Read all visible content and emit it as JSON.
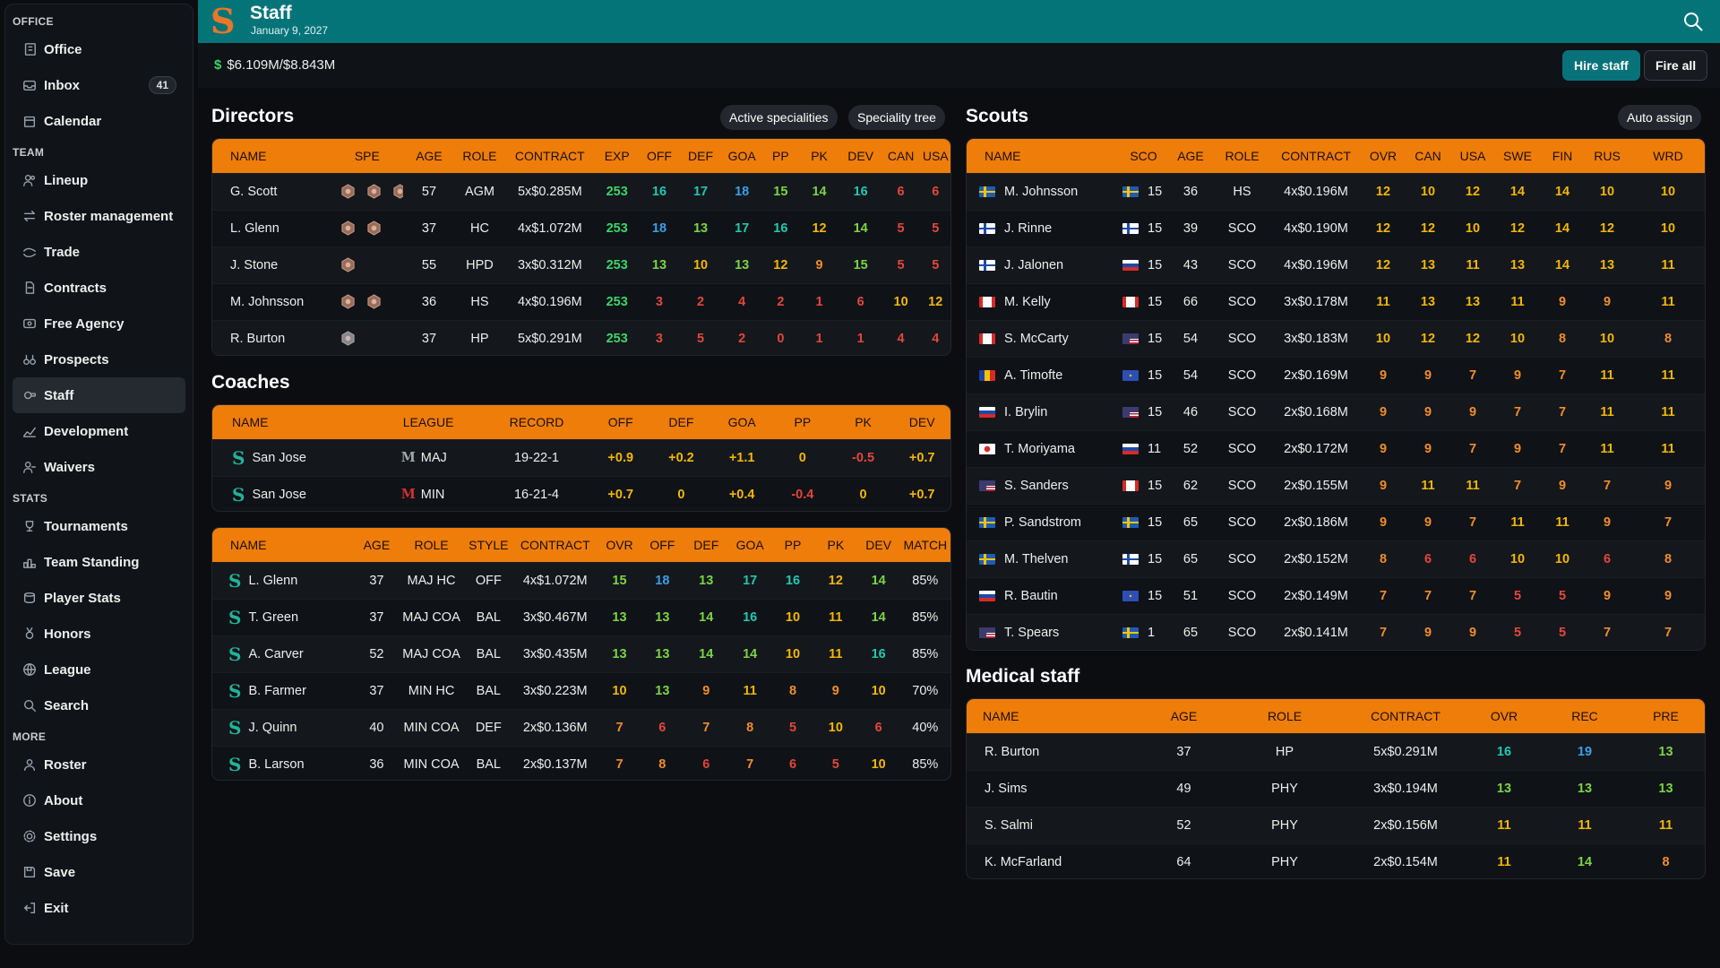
{
  "sidebar": {
    "office_title": "OFFICE",
    "team_title": "TEAM",
    "stats_title": "STATS",
    "more_title": "MORE",
    "office": [
      {
        "label": "Office",
        "icon": "building-icon"
      },
      {
        "label": "Inbox",
        "icon": "inbox-icon",
        "badge": "41"
      },
      {
        "label": "Calendar",
        "icon": "calendar-icon"
      }
    ],
    "team": [
      {
        "label": "Lineup",
        "icon": "users-icon"
      },
      {
        "label": "Roster management",
        "icon": "swap-icon"
      },
      {
        "label": "Trade",
        "icon": "trade-icon"
      },
      {
        "label": "Contracts",
        "icon": "document-icon"
      },
      {
        "label": "Free Agency",
        "icon": "id-card-icon"
      },
      {
        "label": "Prospects",
        "icon": "binoculars-icon"
      },
      {
        "label": "Staff",
        "icon": "whistle-icon",
        "active": true
      },
      {
        "label": "Development",
        "icon": "chart-icon"
      },
      {
        "label": "Waivers",
        "icon": "user-remove-icon"
      }
    ],
    "stats": [
      {
        "label": "Tournaments",
        "icon": "trophy-icon"
      },
      {
        "label": "Team Standing",
        "icon": "podium-icon"
      },
      {
        "label": "Player Stats",
        "icon": "database-icon"
      },
      {
        "label": "Honors",
        "icon": "medal-icon"
      },
      {
        "label": "League",
        "icon": "globe-icon"
      },
      {
        "label": "Search",
        "icon": "search-icon"
      }
    ],
    "more": [
      {
        "label": "Roster",
        "icon": "user-icon"
      },
      {
        "label": "About",
        "icon": "info-icon"
      },
      {
        "label": "Settings",
        "icon": "gear-icon"
      },
      {
        "label": "Save",
        "icon": "save-icon"
      },
      {
        "label": "Exit",
        "icon": "exit-icon"
      }
    ]
  },
  "header": {
    "title": "Staff",
    "date": "January 9, 2027",
    "logo_letter": "S"
  },
  "budget": {
    "symbol": "$",
    "text": "$6.109M/$8.843M"
  },
  "buttons": {
    "hire": "Hire staff",
    "fire": "Fire all",
    "active_spec": "Active specialities",
    "spec_tree": "Speciality tree",
    "auto_assign": "Auto assign"
  },
  "directors": {
    "title": "Directors",
    "columns": [
      "NAME",
      "SPE",
      "AGE",
      "ROLE",
      "CONTRACT",
      "EXP",
      "OFF",
      "DEF",
      "GOA",
      "PP",
      "PK",
      "DEV",
      "CAN",
      "USA"
    ],
    "rows": [
      {
        "name": "G. Scott",
        "spe": 3,
        "age": "57",
        "role": "AGM",
        "contract": "5x$0.285M",
        "stats": [
          "253",
          "16",
          "17",
          "18",
          "15",
          "14",
          "16",
          "6",
          "6"
        ]
      },
      {
        "name": "L. Glenn",
        "spe": 2,
        "age": "37",
        "role": "HC",
        "contract": "4x$1.072M",
        "stats": [
          "253",
          "18",
          "13",
          "17",
          "16",
          "12",
          "14",
          "5",
          "5"
        ]
      },
      {
        "name": "J. Stone",
        "spe": 1,
        "age": "55",
        "role": "HPD",
        "contract": "3x$0.312M",
        "stats": [
          "253",
          "13",
          "10",
          "13",
          "12",
          "9",
          "15",
          "5",
          "5"
        ]
      },
      {
        "name": "M. Johnsson",
        "spe": 2,
        "age": "36",
        "role": "HS",
        "contract": "4x$0.196M",
        "stats": [
          "253",
          "3",
          "2",
          "4",
          "2",
          "1",
          "6",
          "10",
          "12"
        ]
      },
      {
        "name": "R. Burton",
        "spe": 1,
        "age": "37",
        "role": "HP",
        "contract": "5x$0.291M",
        "stats": [
          "253",
          "3",
          "5",
          "2",
          "0",
          "1",
          "1",
          "4",
          "4"
        ]
      }
    ]
  },
  "coaches": {
    "title": "Coaches",
    "columns": [
      "NAME",
      "LEAGUE",
      "RECORD",
      "OFF",
      "DEF",
      "GOA",
      "PP",
      "PK",
      "DEV"
    ],
    "rows": [
      {
        "name": "San Jose",
        "league": "MAJ",
        "record": "19-22-1",
        "stats": [
          "+0.9",
          "+0.2",
          "+1.1",
          "0",
          "-0.5",
          "+0.7"
        ]
      },
      {
        "name": "San Jose",
        "league": "MIN",
        "record": "16-21-4",
        "stats": [
          "+0.7",
          "0",
          "+0.4",
          "-0.4",
          "0",
          "+0.7"
        ]
      }
    ]
  },
  "coach_staff": {
    "columns": [
      "NAME",
      "AGE",
      "ROLE",
      "STYLE",
      "CONTRACT",
      "OVR",
      "OFF",
      "DEF",
      "GOA",
      "PP",
      "PK",
      "DEV",
      "MATCH"
    ],
    "rows": [
      {
        "name": "L. Glenn",
        "age": "37",
        "role": "MAJ HC",
        "style": "OFF",
        "contract": "4x$1.072M",
        "stats": [
          "15",
          "18",
          "13",
          "17",
          "16",
          "12",
          "14"
        ],
        "match": "85%"
      },
      {
        "name": "T. Green",
        "age": "37",
        "role": "MAJ COA",
        "style": "BAL",
        "contract": "3x$0.467M",
        "stats": [
          "13",
          "13",
          "14",
          "16",
          "10",
          "11",
          "14"
        ],
        "match": "85%"
      },
      {
        "name": "A. Carver",
        "age": "52",
        "role": "MAJ COA",
        "style": "BAL",
        "contract": "3x$0.435M",
        "stats": [
          "13",
          "13",
          "14",
          "14",
          "10",
          "11",
          "16"
        ],
        "match": "85%"
      },
      {
        "name": "B. Farmer",
        "age": "37",
        "role": "MIN HC",
        "style": "BAL",
        "contract": "3x$0.223M",
        "stats": [
          "10",
          "13",
          "9",
          "11",
          "8",
          "9",
          "10"
        ],
        "match": "70%"
      },
      {
        "name": "J. Quinn",
        "age": "40",
        "role": "MIN COA",
        "style": "DEF",
        "contract": "2x$0.136M",
        "stats": [
          "7",
          "6",
          "7",
          "8",
          "5",
          "10",
          "6"
        ],
        "match": "40%"
      },
      {
        "name": "B. Larson",
        "age": "36",
        "role": "MIN COA",
        "style": "BAL",
        "contract": "2x$0.137M",
        "stats": [
          "7",
          "8",
          "6",
          "7",
          "6",
          "5",
          "10"
        ],
        "match": "85%"
      }
    ]
  },
  "scouts": {
    "title": "Scouts",
    "columns": [
      "NAME",
      "SCO",
      "AGE",
      "ROLE",
      "CONTRACT",
      "OVR",
      "CAN",
      "USA",
      "SWE",
      "FIN",
      "RUS",
      "WRD"
    ],
    "rows": [
      {
        "name": "M. Johnsson",
        "flag": "SWE",
        "sflag": "SWE",
        "sco": "15",
        "age": "36",
        "role": "HS",
        "contract": "4x$0.196M",
        "stats": [
          "12",
          "10",
          "12",
          "14",
          "14",
          "10",
          "10"
        ]
      },
      {
        "name": "J. Rinne",
        "flag": "FIN",
        "sflag": "FIN",
        "sco": "15",
        "age": "39",
        "role": "SCO",
        "contract": "4x$0.190M",
        "stats": [
          "12",
          "12",
          "10",
          "12",
          "14",
          "12",
          "10"
        ]
      },
      {
        "name": "J. Jalonen",
        "flag": "FIN",
        "sflag": "RUS",
        "sco": "15",
        "age": "43",
        "role": "SCO",
        "contract": "4x$0.196M",
        "stats": [
          "12",
          "13",
          "11",
          "13",
          "14",
          "13",
          "11"
        ]
      },
      {
        "name": "M. Kelly",
        "flag": "CAN",
        "sflag": "CAN",
        "sco": "15",
        "age": "66",
        "role": "SCO",
        "contract": "3x$0.178M",
        "stats": [
          "11",
          "13",
          "13",
          "11",
          "9",
          "9",
          "11"
        ]
      },
      {
        "name": "S. McCarty",
        "flag": "CAN",
        "sflag": "USA",
        "sco": "15",
        "age": "54",
        "role": "SCO",
        "contract": "3x$0.183M",
        "stats": [
          "10",
          "12",
          "12",
          "10",
          "8",
          "10",
          "8"
        ]
      },
      {
        "name": "A. Timofte",
        "flag": "ROU",
        "sflag": "EU",
        "sco": "15",
        "age": "54",
        "role": "SCO",
        "contract": "2x$0.169M",
        "stats": [
          "9",
          "9",
          "7",
          "9",
          "7",
          "11",
          "11"
        ]
      },
      {
        "name": "I. Brylin",
        "flag": "RUS",
        "sflag": "USA",
        "sco": "15",
        "age": "46",
        "role": "SCO",
        "contract": "2x$0.168M",
        "stats": [
          "9",
          "9",
          "9",
          "7",
          "7",
          "11",
          "11"
        ]
      },
      {
        "name": "T. Moriyama",
        "flag": "JPN",
        "sflag": "RUS",
        "sco": "11",
        "age": "52",
        "role": "SCO",
        "contract": "2x$0.172M",
        "stats": [
          "9",
          "9",
          "7",
          "9",
          "7",
          "11",
          "11"
        ]
      },
      {
        "name": "S. Sanders",
        "flag": "USA",
        "sflag": "CAN",
        "sco": "15",
        "age": "62",
        "role": "SCO",
        "contract": "2x$0.155M",
        "stats": [
          "9",
          "11",
          "11",
          "7",
          "9",
          "7",
          "9"
        ]
      },
      {
        "name": "P. Sandstrom",
        "flag": "SWE",
        "sflag": "SWE",
        "sco": "15",
        "age": "65",
        "role": "SCO",
        "contract": "2x$0.186M",
        "stats": [
          "9",
          "9",
          "7",
          "11",
          "11",
          "9",
          "7"
        ]
      },
      {
        "name": "M. Thelven",
        "flag": "SWE",
        "sflag": "FIN",
        "sco": "15",
        "age": "65",
        "role": "SCO",
        "contract": "2x$0.152M",
        "stats": [
          "8",
          "6",
          "6",
          "10",
          "10",
          "6",
          "8"
        ]
      },
      {
        "name": "R. Bautin",
        "flag": "RUS",
        "sflag": "EU",
        "sco": "15",
        "age": "51",
        "role": "SCO",
        "contract": "2x$0.149M",
        "stats": [
          "7",
          "7",
          "7",
          "5",
          "5",
          "9",
          "9"
        ]
      },
      {
        "name": "T. Spears",
        "flag": "USA",
        "sflag": "SWE",
        "sco": "1",
        "age": "65",
        "role": "SCO",
        "contract": "2x$0.141M",
        "stats": [
          "7",
          "9",
          "9",
          "5",
          "5",
          "7",
          "7"
        ]
      }
    ]
  },
  "medical": {
    "title": "Medical staff",
    "columns": [
      "NAME",
      "AGE",
      "ROLE",
      "CONTRACT",
      "OVR",
      "REC",
      "PRE"
    ],
    "rows": [
      {
        "name": "R. Burton",
        "age": "37",
        "role": "HP",
        "contract": "5x$0.291M",
        "stats": [
          "16",
          "19",
          "13"
        ]
      },
      {
        "name": "J. Sims",
        "age": "49",
        "role": "PHY",
        "contract": "3x$0.194M",
        "stats": [
          "13",
          "13",
          "13"
        ]
      },
      {
        "name": "S. Salmi",
        "age": "52",
        "role": "PHY",
        "contract": "2x$0.156M",
        "stats": [
          "11",
          "11",
          "11"
        ]
      },
      {
        "name": "K. McFarland",
        "age": "64",
        "role": "PHY",
        "contract": "2x$0.154M",
        "stats": [
          "11",
          "14",
          "8"
        ]
      }
    ]
  },
  "colors": {
    "header": "#047479",
    "accent": "#ef7d0a",
    "hire": "#08727a"
  }
}
